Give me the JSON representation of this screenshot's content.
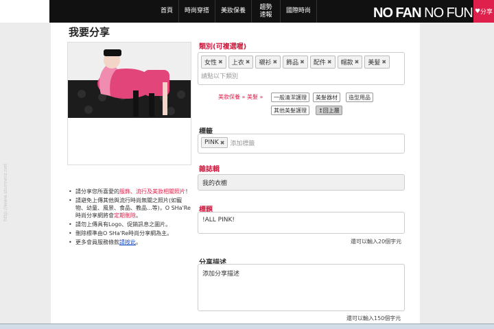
{
  "nav": {
    "items": [
      "首頁",
      "時尚穿搭",
      "美妝保養",
      "趨勢速報",
      "國際時尚"
    ],
    "logo_bold": "NO FAN",
    "logo_thin": "NO FUN",
    "share_tab": "分享"
  },
  "page": {
    "title": "我要分享",
    "watermark": "http://www.stunnerz.net"
  },
  "notes": [
    {
      "pre": "請分享您所喜愛的",
      "red": "服飾、流行及美妝相關照片",
      "post": "！"
    },
    {
      "pre": "請避免上傳其他與流行時尚無關之照片(如寵物、幼童、風景、食品、教品...等)，O SHa'Re時尚分享網將會",
      "red": "定期刪除",
      "post": "。"
    },
    {
      "pre": "請勿上傳具有Logo、促銷訊息之圖片。",
      "red": "",
      "post": ""
    },
    {
      "pre": "刪除標準由O SHa'Re時尚分享網為主。",
      "red": "",
      "post": ""
    },
    {
      "pre": "更多會員服務條款",
      "link": "請按此",
      "post": "。"
    }
  ],
  "category": {
    "label": "類別(可複選喔)",
    "tags": [
      "女性",
      "上衣",
      "襯衫",
      "飾品",
      "配件",
      "帽款",
      "美髮"
    ],
    "placeholder": "請點以下類別",
    "breadcrumb": "美妝保養 » 美髮 »",
    "chips": [
      "一般清潔護理",
      "美髮器材",
      "造型用品",
      "其他美髮護理",
      "↥回上層"
    ]
  },
  "tags_field": {
    "label": "標籤",
    "tags": [
      "PINK"
    ],
    "placeholder": "添加標籤"
  },
  "magazine": {
    "label": "雜誌輯",
    "value": "我的衣櫥"
  },
  "title_field": {
    "label": "標題",
    "value": "!ALL PINK!",
    "hint": "還可以輸入20個字元"
  },
  "description": {
    "label": "分享描述",
    "placeholder": "添加分享描述",
    "hint": "還可以輸入150個字元"
  },
  "colors": {
    "accent": "#e0204c",
    "nav_bg": "#111111"
  }
}
